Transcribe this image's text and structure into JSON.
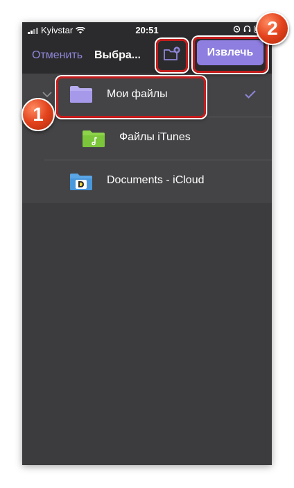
{
  "statusbar": {
    "carrier": "Kyivstar",
    "time": "20:51"
  },
  "navbar": {
    "cancel_label": "Отменить",
    "title": "Выбра...",
    "extract_label": "Извлечь"
  },
  "list": {
    "items": [
      {
        "label": "Мои файлы",
        "icon": "folder-icon",
        "selected": true
      },
      {
        "label": "Файлы iTunes",
        "icon": "itunes-folder-icon"
      },
      {
        "label": "Documents - iCloud",
        "icon": "documents-app-icon"
      }
    ]
  },
  "annotations": {
    "badge_1": "1",
    "badge_2": "2"
  },
  "colors": {
    "accent": "#8e86d8",
    "button": "#8e7ee0",
    "highlight": "#c41d1d"
  }
}
